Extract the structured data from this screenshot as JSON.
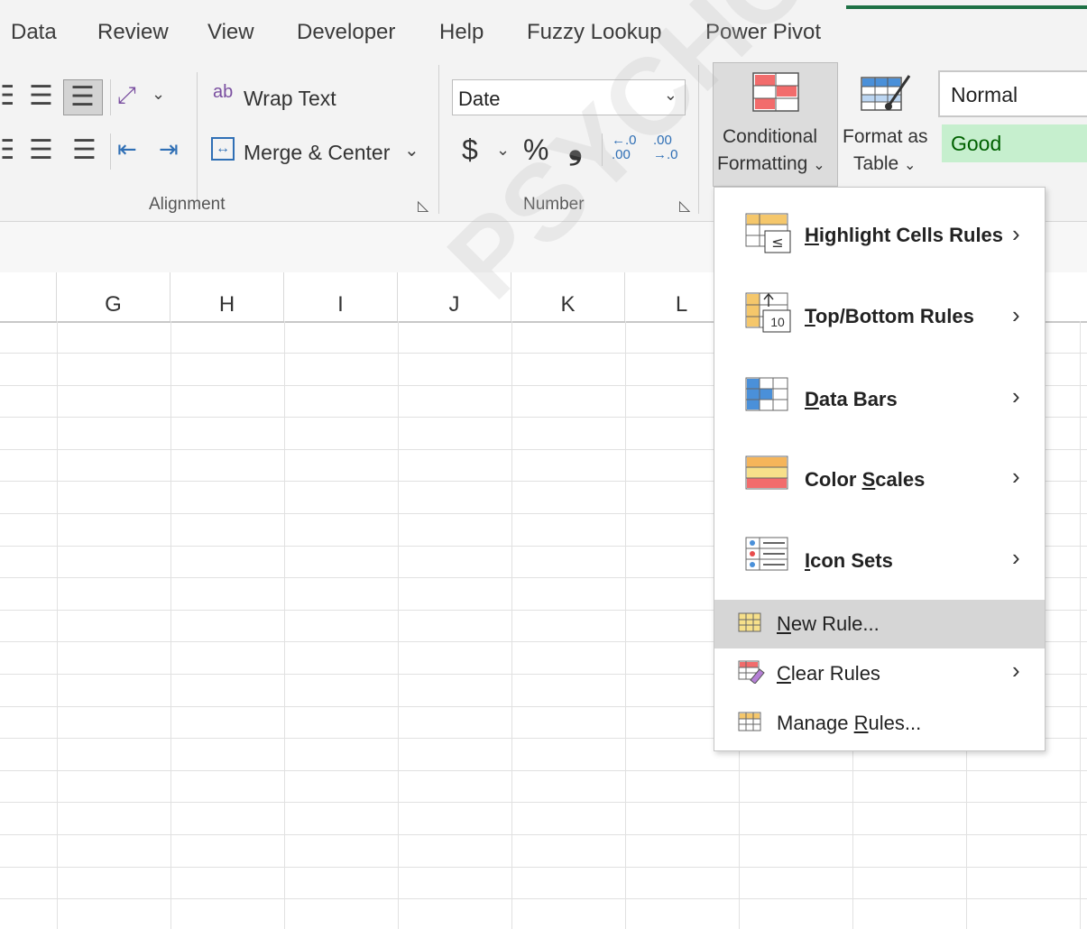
{
  "tabs": [
    "Data",
    "Review",
    "View",
    "Developer",
    "Help",
    "Fuzzy Lookup",
    "Power Pivot"
  ],
  "ribbon": {
    "alignment": {
      "wrap_text_icon": "ab",
      "wrap_text": "Wrap Text",
      "merge_center": "Merge & Center",
      "group_label": "Alignment"
    },
    "number": {
      "format_value": "Date",
      "currency_symbol": "$",
      "percent_symbol": "%",
      "comma_symbol": "❟",
      "group_label": "Number"
    },
    "styles": {
      "conditional_formatting_line1": "Conditional",
      "conditional_formatting_line2": "Formatting",
      "format_as_table_line1": "Format as",
      "format_as_table_line2": "Table",
      "style_normal": "Normal",
      "style_good": "Good"
    }
  },
  "columns": [
    "G",
    "H",
    "I",
    "J",
    "K",
    "L"
  ],
  "menu": {
    "items": [
      {
        "label": "Highlight Cells Rules",
        "icon": "highlight-cells-icon",
        "submenu": true
      },
      {
        "label": "Top/Bottom Rules",
        "icon": "top-bottom-icon",
        "submenu": true
      },
      {
        "label": "Data Bars",
        "icon": "data-bars-icon",
        "submenu": true
      },
      {
        "label": "Color Scales",
        "icon": "color-scales-icon",
        "submenu": true
      },
      {
        "label": "Icon Sets",
        "icon": "icon-sets-icon",
        "submenu": true
      }
    ],
    "small_items": [
      {
        "label": "New Rule...",
        "icon": "new-rule-icon",
        "submenu": false,
        "highlighted": true
      },
      {
        "label": "Clear Rules",
        "icon": "clear-rules-icon",
        "submenu": true
      },
      {
        "label": "Manage Rules...",
        "icon": "manage-rules-icon",
        "submenu": false
      }
    ],
    "top_bottom_badge": "10"
  },
  "watermark": "PSYCHOLOGY.COM",
  "colors": {
    "accent_green": "#1e7145",
    "good_bg": "#c6efce",
    "good_text": "#006100",
    "menu_highlight": "#d6d6d6"
  }
}
